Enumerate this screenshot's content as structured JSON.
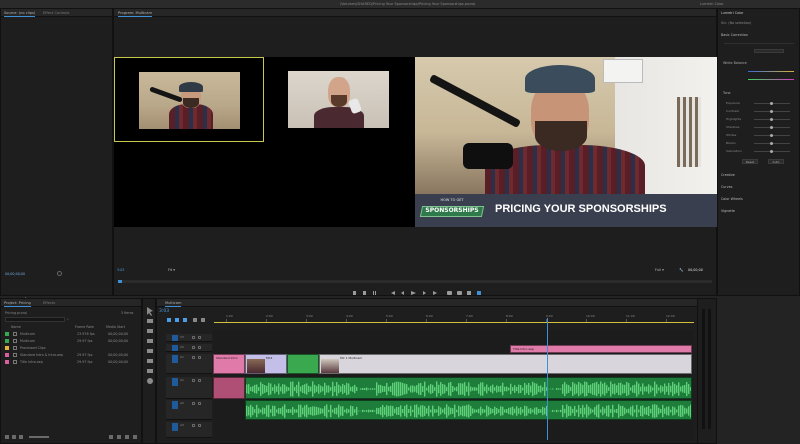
{
  "app": {
    "window_title": "/Volumes/SHARED/Pricing Your Sponsorships/Pricing Your Sponsorships.prproj",
    "top_right": "Lumetri Color"
  },
  "source_panel": {
    "tabs": [
      "Source: (no clips)",
      "Effect Controls"
    ],
    "timecode": "00;00;00;00"
  },
  "program_monitor": {
    "tab": "Program: Multicam",
    "timecode": "3:03",
    "fit": "Fit",
    "quality": "Full",
    "duration": "00;00;00"
  },
  "lower_third": {
    "badge_line1": "HOW TO GET",
    "badge_line2": "SPONSORSHIPS",
    "headline": "PRICING YOUR SPONSORSHIPS"
  },
  "lumetri": {
    "title": "Lumetri Color",
    "source": "Src: (No selection)",
    "sections": [
      "Basic Correction",
      "White Balance",
      "Tone",
      "Creative",
      "Curves",
      "Color Wheels",
      "Vignette"
    ],
    "tone_rows": [
      "Exposure",
      "Contrast",
      "Highlights",
      "Shadows",
      "Whites",
      "Blacks",
      "Saturation"
    ],
    "buttons": [
      "Reset",
      "Auto"
    ]
  },
  "project_panel": {
    "tabs": [
      "Project: Pricing",
      "Effects"
    ],
    "search_value": "Pricing.prproj",
    "item_count": "5 Items",
    "columns": [
      "Name",
      "Frame Rate",
      "Media Start"
    ],
    "items": [
      {
        "name": "Multicam",
        "rate": "23.976 fps",
        "start": "00;00;00;00",
        "color": "#3aa84f"
      },
      {
        "name": "Multicam",
        "rate": "29.97 fps",
        "start": "00;00;00;00",
        "color": "#3aa84f"
      },
      {
        "name": "Processed Clips",
        "rate": "",
        "start": "",
        "color": "#e3b33a"
      },
      {
        "name": "Standard Intro & Intro.aep",
        "rate": "29.97 fps",
        "start": "00;00;00;00",
        "color": "#d85ea0"
      },
      {
        "name": "Title Intro.aep",
        "rate": "29.97 fps",
        "start": "00;00;00;00",
        "color": "#d85ea0"
      }
    ]
  },
  "timeline": {
    "tab": "Multicam",
    "timecode": "3:03",
    "ruler_labels": [
      "1:00",
      "2:00",
      "3:00",
      "4:00",
      "5:00",
      "6:00",
      "7:00",
      "8:00",
      "9:00",
      "10:00",
      "11:00",
      "12:00"
    ],
    "tracks": [
      "V3",
      "V2",
      "V1",
      "A1",
      "A2",
      "A3"
    ],
    "clips": {
      "title_card": "Title Intro.aep",
      "intro": "Standard Intro",
      "mc1": "MC1",
      "mc2": "MC 1 Multicam"
    }
  },
  "colors": {
    "accent_blue": "#3d8fd6",
    "clip_green": "#3aa84f",
    "clip_pink": "#e07aa8",
    "clip_lavender": "#c4bfe8",
    "audio_green": "#1e7d3a",
    "lower_third_bg": "#3a3f4f",
    "badge_green": "#2f7a4a",
    "program_border": "#c8c84a"
  }
}
